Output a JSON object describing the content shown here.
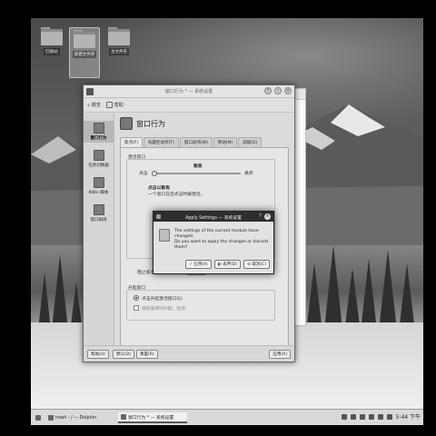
{
  "desktop": {
    "icons": [
      {
        "label": "回收站"
      },
      {
        "label": "新建文件夹"
      },
      {
        "label": "主文件夹"
      }
    ]
  },
  "window": {
    "title": "窗口行为 * — 系统设置",
    "toolbar": {
      "back": "概览",
      "help": "帮助"
    },
    "sidebar": [
      {
        "label": "窗口行为"
      },
      {
        "label": "任务切换器"
      },
      {
        "label": "KWin 脚本"
      },
      {
        "label": "窗口规则"
      }
    ],
    "page_title": "窗口行为",
    "tabs": [
      "焦点(F)",
      "标题栏动作(T)",
      "窗口动作(W)",
      "移动(M)",
      "高级(D)"
    ],
    "pane": {
      "focus_group": "激活窗口",
      "slider_left": "点击",
      "slider_center": "聚焦",
      "slider_right": "悬停",
      "policy_title": "点击以聚焦",
      "policy_desc": "一个窗口在您点击时被激活。",
      "prevent_label": "阻止焦点抢夺(E):",
      "prevent_value": "低",
      "raise_group": "升起窗口",
      "raise_click": "点击升起激活窗口(L)",
      "raise_hover": "鼠标悬停时升起，延迟:"
    },
    "bottom": {
      "help": "帮助(H)",
      "defaults": "默认(D)",
      "reset": "重置(R)",
      "apply": "应用(A)"
    }
  },
  "dialog": {
    "title": "Apply Settings — 系统设置",
    "message_line1": "The settings of the current module have changed.",
    "message_line2": "Do you want to apply the changes or discard them?",
    "buttons": {
      "apply": "应用(A)",
      "discard": "丢弃(D)",
      "cancel": "取消(C)"
    }
  },
  "taskbar": {
    "tasks": [
      {
        "label": "trash - / — Dolphin"
      },
      {
        "label": "窗口行为 * — 系统设置"
      }
    ],
    "clock": "5:44 下午"
  }
}
